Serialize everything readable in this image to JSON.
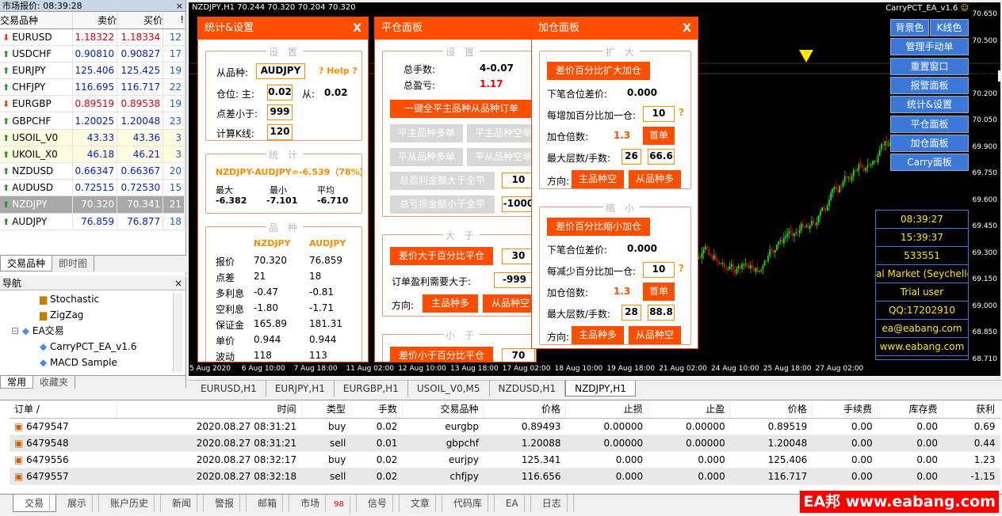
{
  "market_watch": {
    "title": "市场报价: 08:39:28",
    "close": "×",
    "headers": [
      "交易品种",
      "卖价",
      "买价",
      "!"
    ],
    "rows": [
      {
        "sym": "EURUSD",
        "bid": "1.18322",
        "ask": "1.18334",
        "spread": "12",
        "dir": "dn",
        "color": "rd"
      },
      {
        "sym": "USDCHF",
        "bid": "0.90810",
        "ask": "0.90827",
        "spread": "17",
        "dir": "up",
        "color": "bl"
      },
      {
        "sym": "EURJPY",
        "bid": "125.406",
        "ask": "125.425",
        "spread": "19",
        "dir": "up",
        "color": "bl"
      },
      {
        "sym": "CHFJPY",
        "bid": "116.695",
        "ask": "116.717",
        "spread": "22",
        "dir": "up",
        "color": "bl"
      },
      {
        "sym": "EURGBP",
        "bid": "0.89519",
        "ask": "0.89538",
        "spread": "19",
        "dir": "dn",
        "color": "rd"
      },
      {
        "sym": "GBPCHF",
        "bid": "1.20025",
        "ask": "1.20048",
        "spread": "23",
        "dir": "up",
        "color": "bl"
      },
      {
        "sym": "USOIL_V0",
        "bid": "43.33",
        "ask": "43.36",
        "spread": "3",
        "dir": "up",
        "color": "bl",
        "yellow": true
      },
      {
        "sym": "UKOIL_X0",
        "bid": "46.18",
        "ask": "46.21",
        "spread": "3",
        "dir": "up",
        "color": "bl",
        "yellow": true
      },
      {
        "sym": "NZDUSD",
        "bid": "0.66347",
        "ask": "0.66367",
        "spread": "20",
        "dir": "up",
        "color": "bl"
      },
      {
        "sym": "AUDUSD",
        "bid": "0.72515",
        "ask": "0.72530",
        "spread": "15",
        "dir": "up",
        "color": "bl"
      },
      {
        "sym": "NZDJPY",
        "bid": "70.320",
        "ask": "70.341",
        "spread": "21",
        "dir": "up",
        "color": "sel",
        "selected": true
      },
      {
        "sym": "AUDJPY",
        "bid": "76.859",
        "ask": "76.877",
        "spread": "18",
        "dir": "up",
        "color": "bl"
      }
    ],
    "tabs": [
      "交易品种",
      "即时图"
    ]
  },
  "navigator": {
    "title": "导航",
    "close": "×",
    "items": [
      "Stochastic",
      "ZigZag",
      "EA交易",
      "CarryPCT_EA_v1.6",
      "MACD Sample"
    ],
    "tabs": [
      "常用",
      "收藏夹"
    ]
  },
  "chart": {
    "title": "NZDJPY,H1  70.244 70.320 70.204 70.320",
    "ea_name": "CarryPCT_EA_v1.6",
    "smiley": "☺",
    "prices": [
      "70.650",
      "70.500",
      "70.320",
      "70.200",
      "70.050",
      "69.900",
      "69.750",
      "69.600",
      "69.450",
      "69.300",
      "69.150",
      "69.000",
      "68.850",
      "68.710"
    ],
    "times": [
      "5 Aug 2020",
      "6 Aug 10:00",
      "7 Aug 18:00",
      "11 Aug 02:00",
      "12 Aug 10:00",
      "13 Aug 18:00",
      "17 Aug 02:00",
      "18 Aug 10:00",
      "19 Aug 18:00",
      "21 Aug 02:00",
      "24 Aug 10:00",
      "25 Aug 18:00",
      "27 Aug 02:00"
    ]
  },
  "side_buttons": [
    "背景色",
    "K线色",
    "管理手动单",
    "重置窗口",
    "报警面板",
    "统计&设置",
    "平仓面板",
    "加仓面板",
    "Carry面板"
  ],
  "info_box": [
    "08:39:27",
    "15:39:37",
    "533551",
    "al Market (Seychelle",
    "Trial user",
    "QQ:17202910",
    "ea@eabang.com",
    "www.eabang.com"
  ],
  "stats_panel": {
    "title": "统计&设置",
    "close": "X",
    "sec_settings": "设 置",
    "from_label": "从品种:",
    "from_value": "AUDJPY",
    "help": "? Help ?",
    "pos_label": "仓位: 主:",
    "pos_main": "0.02",
    "pos_from_label": "从:",
    "pos_from": "0.02",
    "spread_label": "点差小于:",
    "spread_value": "999",
    "k_label": "计算K线:",
    "k_value": "120",
    "sec_stats": "统 计",
    "pair_stat": "NZDJPY-AUDJPY=-6.539（78%）",
    "max_label": "最大",
    "max_value": "-6.382",
    "min_label": "最小",
    "min_value": "-7.101",
    "avg_label": "平均",
    "avg_value": "-6.710",
    "sec_sym": "品 种",
    "col1": "NZDJPY",
    "col2": "AUDJPY",
    "rows": [
      [
        "报价",
        "70.320",
        "76.859"
      ],
      [
        "点差",
        "21",
        "18"
      ],
      [
        "多利息",
        "-0.47",
        "-0.81"
      ],
      [
        "空利息",
        "-1.80",
        "-1.71"
      ],
      [
        "保证金",
        "165.89",
        "181.31"
      ],
      [
        "单价",
        "0.944",
        "0.944"
      ],
      [
        "波动",
        "118",
        "113"
      ]
    ]
  },
  "close_panel": {
    "title": "平仓面板",
    "sec_settings": "设 置",
    "lots_label": "总手数:",
    "lots_value": "4-0.07",
    "profit_label": "总盈亏:",
    "profit_value": "1.17",
    "close_all": "一键全平主品种从品种订单",
    "main_buy": "平主品种多单",
    "main_sell": "平主品种空单",
    "from_buy": "平从品种多单",
    "from_sell": "平从品种空单",
    "profit_gt": "总盈利金额大于全平",
    "profit_gt_value": "10",
    "loss_gt": "总亏损金额小于全平",
    "loss_gt_value": "-1000",
    "sec_gt": "大 于",
    "diff_gt": "差价大于百分比平仓",
    "diff_gt_value": "30",
    "order_profit_label": "订单盈利需要大于:",
    "order_profit_value": "-999",
    "dir_label": "方向:",
    "dir_main_buy": "主品种多",
    "dir_from_sell": "从品种空",
    "sec_lt": "小 于",
    "diff_lt": "差价小于百分比平仓",
    "diff_lt_value": "70"
  },
  "add_panel": {
    "title": "加仓面板",
    "close": "X",
    "sec_expand": "扩 大",
    "expand_btn": "差价百分比扩大加仓",
    "next_label": "下笔合位差价:",
    "next_value": "0.000",
    "step_label": "每增加百分比加一仓:",
    "step_value": "10",
    "q": "?",
    "mult_label": "加仓倍数:",
    "mult_value": "1.3",
    "first_btn": "首单",
    "max_label": "最大层数/手数:",
    "max_layers": "26",
    "max_lots": "66.6",
    "dir_label": "方向:",
    "dir_a": "主品种空",
    "dir_b": "从品种多",
    "sec_shrink": "缩 小",
    "shrink_btn": "差价百分比缩小加仓",
    "next2_label": "下笔合位差价:",
    "next2_value": "0.000",
    "step2_label": "每减少百分比加一仓:",
    "step2_value": "10",
    "mult2_label": "加仓倍数:",
    "mult2_value": "1.3",
    "first2_btn": "首单",
    "max2_label": "最大层数/手数:",
    "max2_layers": "28",
    "max2_lots": "88.8",
    "dir2_a": "主品种多",
    "dir2_b": "从品种空"
  },
  "symbol_tabs": [
    "EURUSD,H1",
    "EURJPY,H1",
    "EURGBP,H1",
    "USOIL_V0,M5",
    "NZDUSD,H1",
    "NZDJPY,H1"
  ],
  "terminal": {
    "headers": [
      "订单 /",
      "时间",
      "类型",
      "手数",
      "交易品种",
      "价格",
      "止损",
      "止盈",
      "价格",
      "手续费",
      "库存费",
      "获利"
    ],
    "rows": [
      [
        "6479547",
        "2020.08.27 08:31:21",
        "buy",
        "0.02",
        "eurgbp",
        "0.89493",
        "0.00000",
        "0.00000",
        "0.89519",
        "0.00",
        "0.00",
        "0.69"
      ],
      [
        "6479548",
        "2020.08.27 08:31:21",
        "sell",
        "0.01",
        "gbpchf",
        "1.20088",
        "0.00000",
        "0.00000",
        "1.20048",
        "0.00",
        "0.00",
        "0.44"
      ],
      [
        "6479556",
        "2020.08.27 08:32:17",
        "buy",
        "0.02",
        "eurjpy",
        "125.341",
        "0.000",
        "0.000",
        "125.406",
        "0.00",
        "0.00",
        "1.23"
      ],
      [
        "6479557",
        "2020.08.27 08:32:18",
        "sell",
        "0.02",
        "chfjpy",
        "116.656",
        "0.000",
        "0.000",
        "116.717",
        "0.00",
        "0.00",
        "-1.15"
      ]
    ],
    "tabs": [
      "交易",
      "展示",
      "账户历史",
      "新闻",
      "警报",
      "邮箱",
      "市场",
      "信号",
      "文章",
      "代码库",
      "EA",
      "日志"
    ],
    "market_badge": "98"
  },
  "watermark": "EA邦 www.eabang.com"
}
